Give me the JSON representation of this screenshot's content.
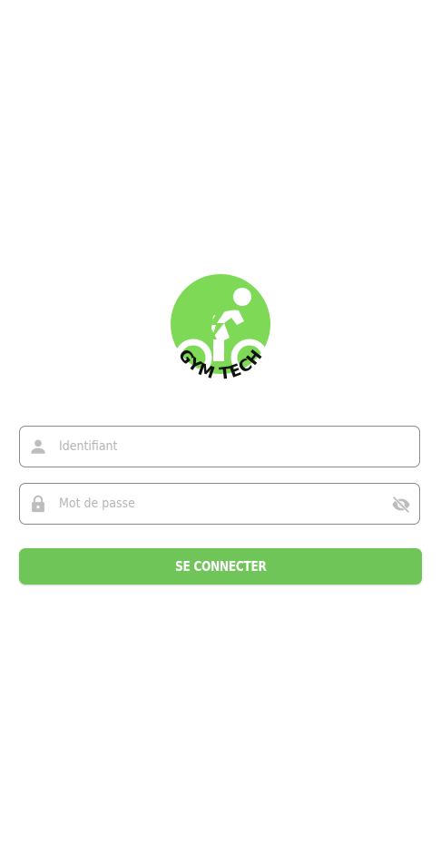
{
  "logo": {
    "text": "GYM TECH",
    "icon": "cyclist-bolt-icon",
    "color": "#7ed957"
  },
  "login": {
    "username_placeholder": "Identifiant",
    "username_value": "",
    "password_placeholder": "Mot de passe",
    "password_value": "",
    "submit_label": "SE CONNECTER"
  },
  "colors": {
    "accent": "#6fc557",
    "icon_gray": "#bdbdbd",
    "border": "#8a8a8a"
  }
}
